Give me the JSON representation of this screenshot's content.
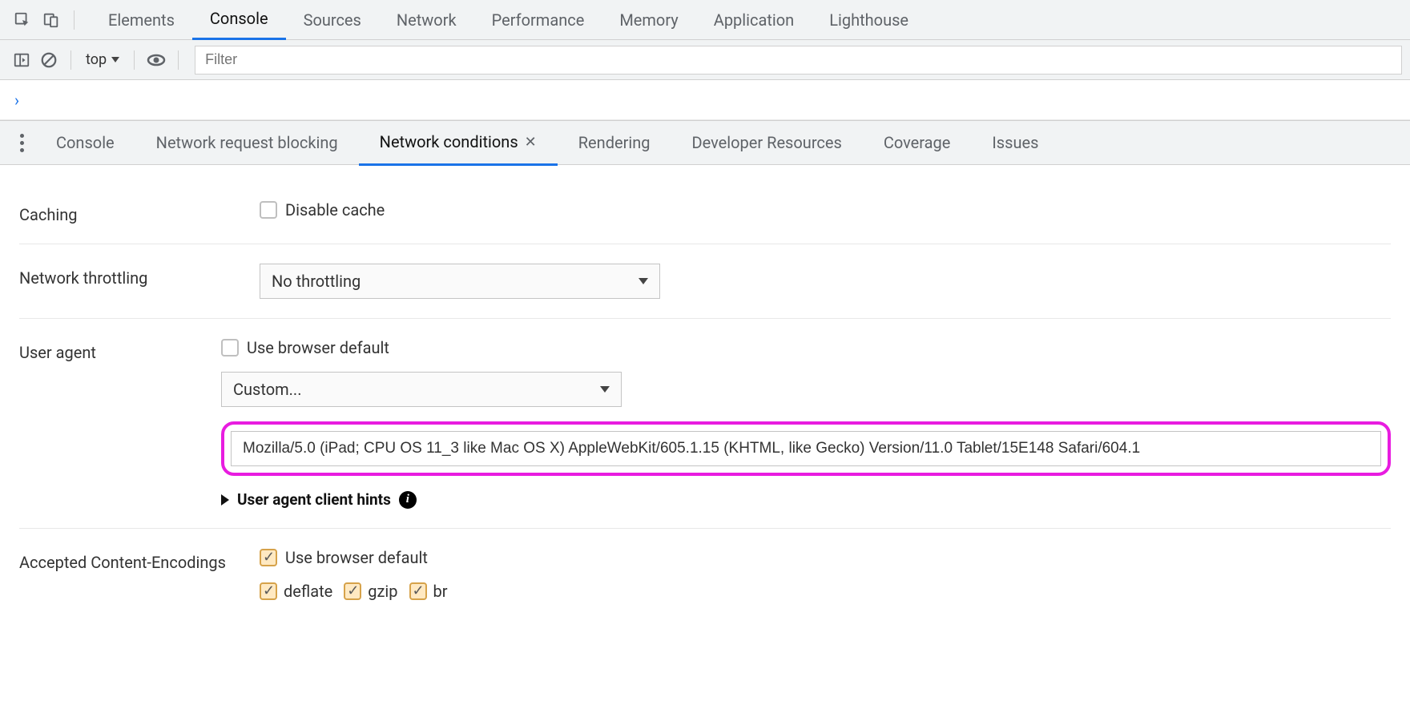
{
  "main_tabs": {
    "elements": "Elements",
    "console": "Console",
    "sources": "Sources",
    "network": "Network",
    "performance": "Performance",
    "memory": "Memory",
    "application": "Application",
    "lighthouse": "Lighthouse",
    "active": "console"
  },
  "console_toolbar": {
    "context": "top",
    "filter_placeholder": "Filter"
  },
  "drawer_tabs": {
    "console": "Console",
    "network_request_blocking": "Network request blocking",
    "network_conditions": "Network conditions",
    "rendering": "Rendering",
    "developer_resources": "Developer Resources",
    "coverage": "Coverage",
    "issues": "Issues",
    "active": "network_conditions"
  },
  "sections": {
    "caching": {
      "label": "Caching",
      "disable_cache": "Disable cache",
      "disable_cache_checked": false
    },
    "throttling": {
      "label": "Network throttling",
      "value": "No throttling"
    },
    "user_agent": {
      "label": "User agent",
      "use_default": "Use browser default",
      "use_default_checked": false,
      "preset": "Custom...",
      "custom_value": "Mozilla/5.0 (iPad; CPU OS 11_3 like Mac OS X) AppleWebKit/605.1.15 (KHTML, like Gecko) Version/11.0 Tablet/15E148 Safari/604.1",
      "client_hints": "User agent client hints"
    },
    "encodings": {
      "label": "Accepted Content-Encodings",
      "use_default": "Use browser default",
      "use_default_checked": true,
      "options": {
        "deflate": {
          "label": "deflate",
          "checked": true
        },
        "gzip": {
          "label": "gzip",
          "checked": true
        },
        "br": {
          "label": "br",
          "checked": true
        }
      }
    }
  }
}
